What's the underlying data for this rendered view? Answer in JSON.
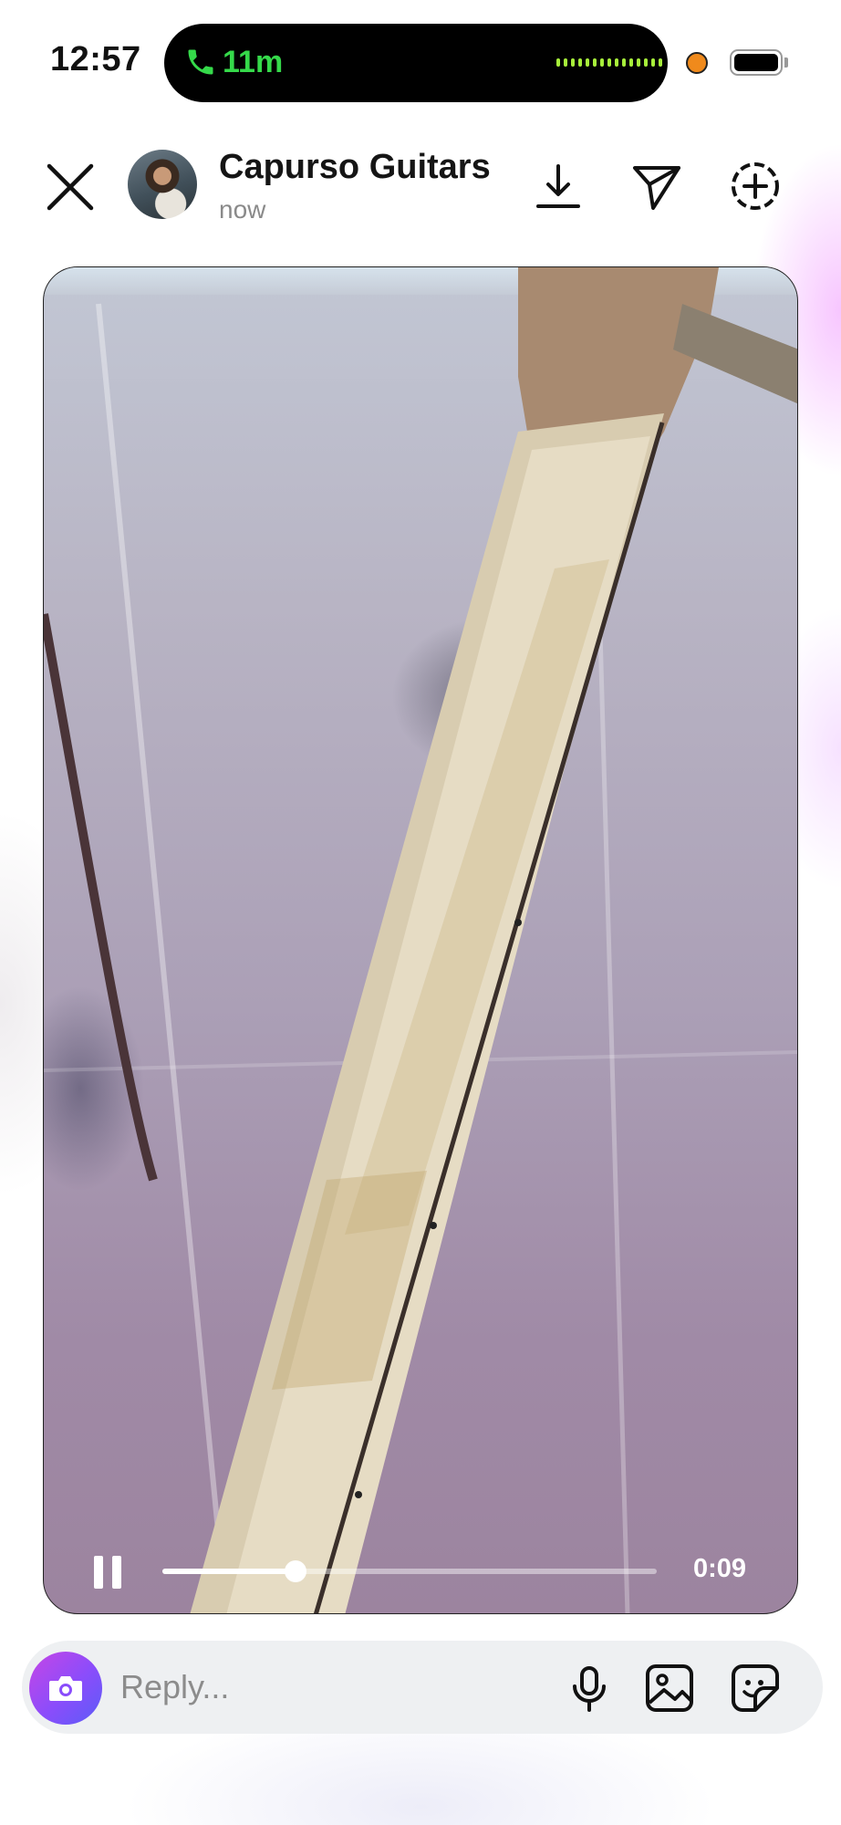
{
  "status_bar": {
    "time": "12:57",
    "call_duration": "11m",
    "call_icon": "phone-icon",
    "recording_indicator_color": "#f08a1c"
  },
  "header": {
    "username": "Capurso Guitars",
    "timestamp": "now",
    "close_icon": "close-icon",
    "download_icon": "download-icon",
    "share_icon": "send-icon",
    "add_icon": "add-circle-icon"
  },
  "video": {
    "elapsed": "0:09",
    "progress_fraction": 0.27,
    "state": "playing"
  },
  "reply": {
    "placeholder": "Reply...",
    "camera_icon": "camera-icon",
    "mic_icon": "microphone-icon",
    "gallery_icon": "image-icon",
    "sticker_icon": "sticker-icon"
  },
  "colors": {
    "call_green": "#35d94a",
    "camera_gradient_start": "#c646e6",
    "camera_gradient_end": "#5b5cf7"
  }
}
